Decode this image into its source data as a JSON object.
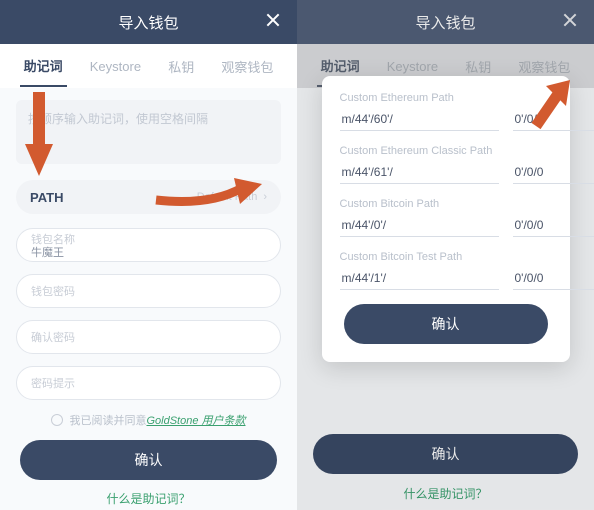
{
  "screen1": {
    "header_title": "导入钱包",
    "tabs": [
      "助记词",
      "Keystore",
      "私钥",
      "观察钱包"
    ],
    "active_tab_index": 0,
    "mnemonic_placeholder": "按顺序输入助记词，使用空格间隔",
    "path_label": "PATH",
    "path_value": "Default Path",
    "fields": {
      "wallet_name_label": "钱包名称",
      "wallet_name_value": "牛魔王",
      "wallet_pwd_label": "钱包密码",
      "confirm_pwd_label": "确认密码",
      "pwd_hint_label": "密码提示"
    },
    "terms_prefix": "我已阅读并同意 ",
    "terms_link": "GoldStone 用户条款",
    "confirm_button": "确认",
    "help_link": "什么是助记词？"
  },
  "screen2": {
    "header_title": "导入钱包",
    "tabs": [
      "助记词",
      "Keystore",
      "私钥",
      "观察钱包"
    ],
    "modal": {
      "groups": [
        {
          "label": "Custom Ethereum Path",
          "prefix": "m/44'/60'/",
          "suffix": "0'/0/0"
        },
        {
          "label": "Custom Ethereum Classic Path",
          "prefix": "m/44'/61'/",
          "suffix": "0'/0/0"
        },
        {
          "label": "Custom Bitcoin Path",
          "prefix": "m/44'/0'/",
          "suffix": "0'/0/0"
        },
        {
          "label": "Custom Bitcoin Test Path",
          "prefix": "m/44'/1'/",
          "suffix": "0'/0/0"
        }
      ],
      "confirm_button": "确认"
    },
    "confirm_button_bg": "确认",
    "help_link": "什么是助记词？"
  }
}
